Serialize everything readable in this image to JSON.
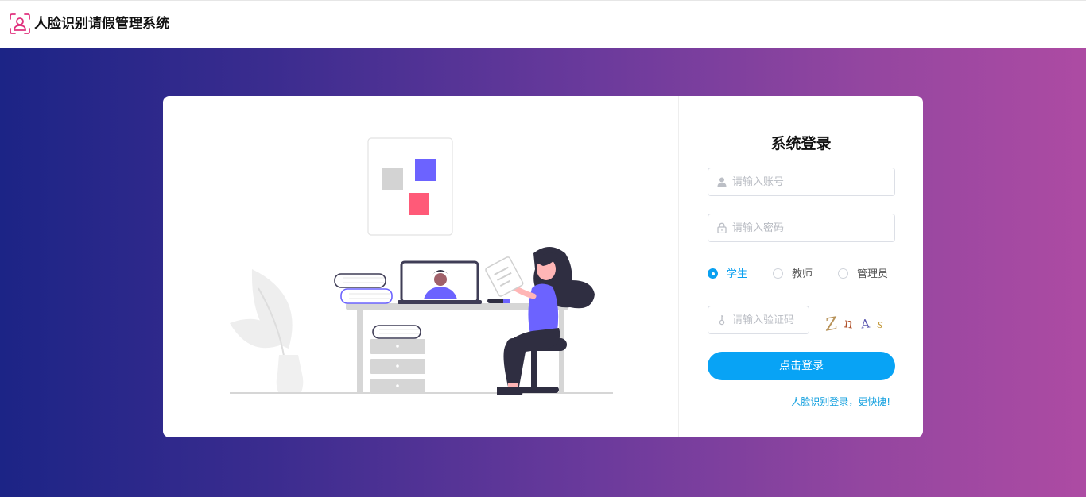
{
  "app": {
    "title": "人脸识别请假管理系统",
    "logo_icon": "face-user-icon",
    "brand_color": "#e0327e"
  },
  "background": {
    "gradient_from": "#1c2486",
    "gradient_to": "#ad4ba3"
  },
  "login": {
    "title": "系统登录",
    "account": {
      "placeholder": "请输入账号",
      "value": "",
      "icon": "user-icon"
    },
    "password": {
      "placeholder": "请输入密码",
      "value": "",
      "icon": "lock-icon"
    },
    "roles": [
      {
        "label": "学生",
        "selected": true
      },
      {
        "label": "教师",
        "selected": false
      },
      {
        "label": "管理员",
        "selected": false
      }
    ],
    "captcha": {
      "placeholder": "请输入验证码",
      "value": "",
      "icon": "key-icon",
      "image_chars": [
        "Z",
        "n",
        "A",
        "s"
      ]
    },
    "submit_label": "点击登录",
    "face_login_link": "人脸识别登录，更快捷!",
    "accent_color": "#08a3f5"
  }
}
